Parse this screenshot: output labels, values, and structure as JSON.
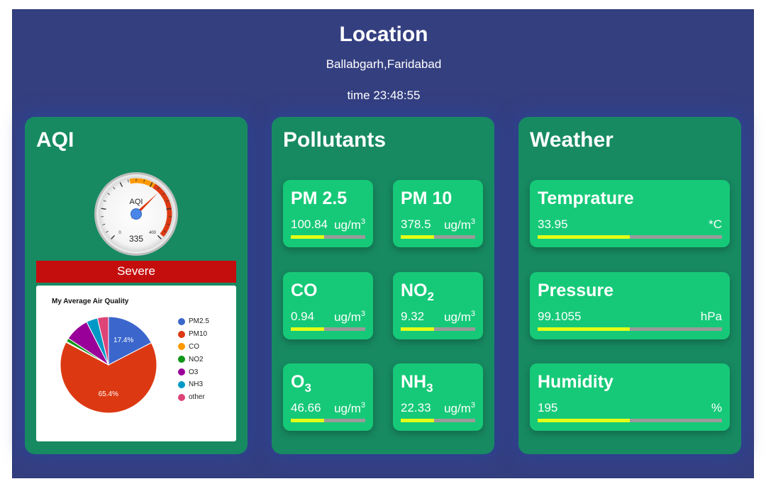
{
  "header": {
    "title": "Location",
    "location": "Ballabgarh,Faridabad",
    "time": "time 23:48:55"
  },
  "aqi": {
    "title": "AQI",
    "gauge": {
      "label": "AQI",
      "value": 335,
      "min_label": "0",
      "max_label": "400",
      "min": 0,
      "max": 500
    },
    "status": "Severe",
    "status_color": "#c40e0e"
  },
  "chart_data": {
    "type": "pie",
    "title": "My Average Air Quality",
    "categories": [
      "PM2.5",
      "PM10",
      "CO",
      "NO2",
      "O3",
      "NH3",
      "other"
    ],
    "values": [
      17.4,
      65.4,
      0.3,
      1.2,
      8.2,
      3.8,
      3.7
    ],
    "colors": [
      "#3b66cc",
      "#dc3912",
      "#ff9900",
      "#109618",
      "#990099",
      "#0099c6",
      "#dd4477"
    ],
    "slice_labels": [
      "17.4%",
      "65.4%",
      "",
      "",
      "",
      "",
      ""
    ],
    "legend": "right"
  },
  "pollutants": {
    "title": "Pollutants",
    "items": [
      {
        "name": "PM 2.5",
        "sub": "",
        "value": "100.84",
        "unit": "ug/m",
        "unit_sup": "3",
        "level": 0.45
      },
      {
        "name": "PM 10",
        "sub": "",
        "value": "378.5",
        "unit": "ug/m",
        "unit_sup": "3",
        "level": 0.45
      },
      {
        "name": "CO",
        "sub": "",
        "value": "0.94",
        "unit": "ug/m",
        "unit_sup": "3",
        "level": 0.45
      },
      {
        "name": "NO",
        "sub": "2",
        "value": "9.32",
        "unit": "ug/m",
        "unit_sup": "3",
        "level": 0.45
      },
      {
        "name": "O",
        "sub": "3",
        "value": "46.66",
        "unit": "ug/m",
        "unit_sup": "3",
        "level": 0.45
      },
      {
        "name": "NH",
        "sub": "3",
        "value": "22.33",
        "unit": "ug/m",
        "unit_sup": "3",
        "level": 0.45
      }
    ]
  },
  "weather": {
    "title": "Weather",
    "items": [
      {
        "name": "Temprature",
        "value": "33.95",
        "unit": "*C",
        "level": 0.5
      },
      {
        "name": "Pressure",
        "value": "99.1055",
        "unit": "hPa",
        "level": 0.5
      },
      {
        "name": "Humidity",
        "value": "195",
        "unit": "%",
        "level": 0.5
      }
    ]
  },
  "colors": {
    "background": "#343f80",
    "panel": "#178a62",
    "card": "#16c978",
    "bar_fill": "#e4ff16",
    "bar_track": "#9a9a9a"
  }
}
